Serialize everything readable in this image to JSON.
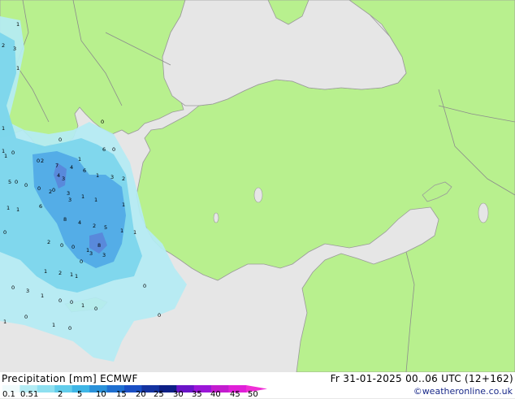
{
  "map": {
    "title": "Precipitation [mm]",
    "model": "ECMWF",
    "valid_time": "Fr 31-01-2025 00..06 UTC (12+162)",
    "credit": "©weatheronline.co.uk",
    "colors": {
      "land": "#b8f08e",
      "sea": "#e6e6e6",
      "border": "#9a9a9a",
      "precip_light": "#b4ecf4",
      "precip_mid": "#7cd6ec",
      "precip_heavy": "#4fa8e6",
      "precip_core": "#5b82d8"
    }
  },
  "legend": {
    "ticks": [
      "0.1",
      "0.5",
      "1",
      "2",
      "5",
      "10",
      "15",
      "20",
      "25",
      "30",
      "35",
      "40",
      "45",
      "50"
    ],
    "colors": [
      "#f0fbfc",
      "#b4ecf4",
      "#8fe0f0",
      "#62cdeb",
      "#3fb6e6",
      "#2a92da",
      "#1f6fd0",
      "#1a4fc4",
      "#1433a0",
      "#0d1f86",
      "#6a14c8",
      "#9b16d8",
      "#c31ccf",
      "#e020d8",
      "#f02fd6"
    ]
  },
  "point_values": [
    {
      "v": "1"
    },
    {
      "v": "2"
    },
    {
      "v": "3"
    },
    {
      "v": "1"
    },
    {
      "v": "1"
    },
    {
      "v": "0"
    },
    {
      "v": "1"
    },
    {
      "v": "0"
    },
    {
      "v": "1"
    },
    {
      "v": "0"
    },
    {
      "v": "0"
    },
    {
      "v": "2"
    },
    {
      "v": "1"
    },
    {
      "v": "4"
    },
    {
      "v": "7"
    },
    {
      "v": "6"
    },
    {
      "v": "0"
    },
    {
      "v": "6"
    },
    {
      "v": "1"
    },
    {
      "v": "0"
    },
    {
      "v": "5"
    },
    {
      "v": "0"
    },
    {
      "v": "4"
    },
    {
      "v": "3"
    },
    {
      "v": "0"
    },
    {
      "v": "2"
    },
    {
      "v": "3"
    },
    {
      "v": "1"
    },
    {
      "v": "1"
    },
    {
      "v": "0"
    },
    {
      "v": "3"
    },
    {
      "v": "2"
    },
    {
      "v": "1"
    },
    {
      "v": "1"
    },
    {
      "v": "0"
    },
    {
      "v": "6"
    },
    {
      "v": "3"
    },
    {
      "v": "8"
    },
    {
      "v": "1"
    },
    {
      "v": "4"
    },
    {
      "v": "2"
    },
    {
      "v": "5"
    },
    {
      "v": "1"
    },
    {
      "v": "1"
    },
    {
      "v": "0"
    },
    {
      "v": "2"
    },
    {
      "v": "0"
    },
    {
      "v": "8"
    },
    {
      "v": "1"
    },
    {
      "v": "3"
    },
    {
      "v": "3"
    },
    {
      "v": "1"
    },
    {
      "v": "0"
    },
    {
      "v": "1"
    },
    {
      "v": "2"
    },
    {
      "v": "1"
    },
    {
      "v": "0"
    },
    {
      "v": "3"
    },
    {
      "v": "1"
    },
    {
      "v": "0"
    },
    {
      "v": "0"
    },
    {
      "v": "1"
    },
    {
      "v": "0"
    },
    {
      "v": "1"
    },
    {
      "v": "0"
    },
    {
      "v": "0"
    },
    {
      "v": "0"
    },
    {
      "v": "1"
    },
    {
      "v": "0"
    }
  ]
}
